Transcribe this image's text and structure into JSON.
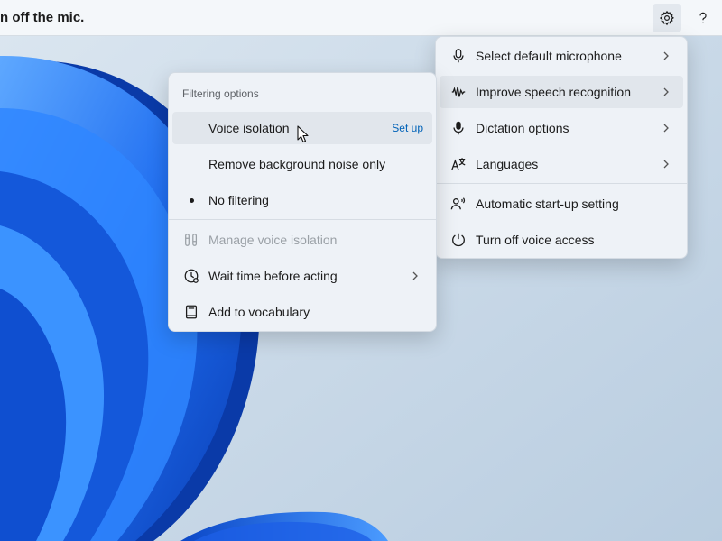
{
  "topbar": {
    "status_text": "n off the mic.",
    "settings_icon": "gear-icon",
    "help_icon": "question-mark-icon"
  },
  "main_menu": {
    "items": [
      {
        "label": "Select default microphone",
        "icon": "microphone-icon",
        "has_submenu": true
      },
      {
        "label": "Improve speech recognition",
        "icon": "speech-waveform-icon",
        "has_submenu": true
      },
      {
        "label": "Dictation options",
        "icon": "microphone-icon",
        "has_submenu": true
      },
      {
        "label": "Languages",
        "icon": "language-icon",
        "has_submenu": true
      },
      {
        "label": "Automatic start-up setting",
        "icon": "person-voice-icon",
        "has_submenu": false
      },
      {
        "label": "Turn off voice access",
        "icon": "power-icon",
        "has_submenu": false
      }
    ]
  },
  "sub_menu": {
    "section_title": "Filtering options",
    "voice_isolation": {
      "label": "Voice isolation",
      "action": "Set up"
    },
    "remove_noise": {
      "label": "Remove background noise only"
    },
    "no_filtering": {
      "label": "No filtering",
      "selected": true
    },
    "manage_isolation": {
      "label": "Manage voice isolation",
      "disabled": true
    },
    "wait_time": {
      "label": "Wait time before acting",
      "has_submenu": true
    },
    "add_vocab": {
      "label": "Add to vocabulary"
    }
  },
  "colors": {
    "accent": "#0062b8",
    "menu_bg": "#eef2f7",
    "wallpaper_blue": "#1b63e0"
  }
}
